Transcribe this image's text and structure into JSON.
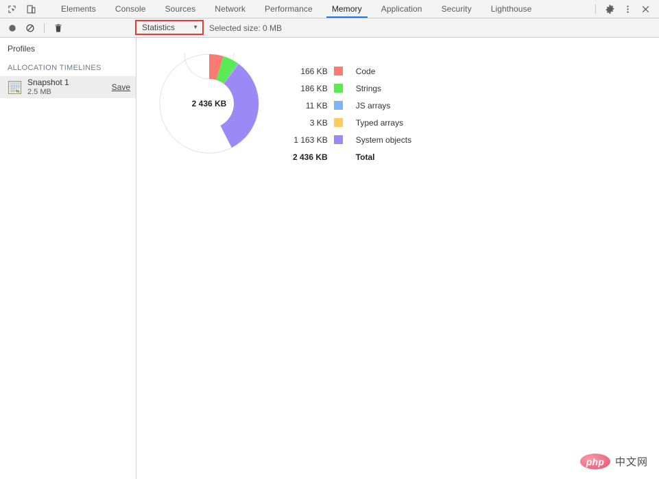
{
  "tabbar": {
    "left_icons": [
      {
        "name": "inspect-element-icon",
        "label": "Inspect element"
      },
      {
        "name": "device-toolbar-icon",
        "label": "Toggle device toolbar"
      }
    ],
    "tabs": [
      {
        "label": "Elements",
        "active": false
      },
      {
        "label": "Console",
        "active": false
      },
      {
        "label": "Sources",
        "active": false
      },
      {
        "label": "Network",
        "active": false
      },
      {
        "label": "Performance",
        "active": false
      },
      {
        "label": "Memory",
        "active": true
      },
      {
        "label": "Application",
        "active": false
      },
      {
        "label": "Security",
        "active": false
      },
      {
        "label": "Lighthouse",
        "active": false
      }
    ],
    "right_icons": [
      {
        "name": "gear-icon",
        "label": "Settings"
      },
      {
        "name": "more-vertical-icon",
        "label": "Customize and control DevTools"
      },
      {
        "name": "close-icon",
        "label": "Close DevTools"
      }
    ],
    "active_tab_underline_color": "#1a73e8"
  },
  "toolbar": {
    "icons": [
      {
        "name": "record-icon",
        "label": "Start recording heap profile"
      },
      {
        "name": "clear-icon",
        "label": "Clear all profiles"
      },
      {
        "name": "trash-icon",
        "label": "Delete profile"
      }
    ],
    "view_select": {
      "value": "Statistics",
      "caret": "▼",
      "highlight_color": "#e53935"
    },
    "selected_size": "Selected size: 0 MB"
  },
  "sidebar": {
    "title": "Profiles",
    "section_label": "ALLOCATION TIMELINES",
    "items": [
      {
        "name": "Snapshot 1",
        "size": "2.5 MB",
        "action_label": "Save",
        "icon": "heap-snapshot-icon",
        "selected": true
      }
    ]
  },
  "chart_data": {
    "type": "pie",
    "title": "Heap snapshot statistics",
    "center_label": "2 436 KB",
    "unit": "KB",
    "total": 2436,
    "scale_max": 3600,
    "legend_position": "right",
    "categories": [
      "Code",
      "Strings",
      "JS arrays",
      "Typed arrays",
      "System objects"
    ],
    "values": [
      166,
      186,
      11,
      3,
      1163
    ],
    "colors": [
      "#fa7b72",
      "#5aea54",
      "#7cb5f7",
      "#ffcb60",
      "#9b8af5"
    ],
    "rows": [
      {
        "size": "166 KB",
        "color": "#fa7b72",
        "name": "Code",
        "value": 166
      },
      {
        "size": "186 KB",
        "color": "#5aea54",
        "name": "Strings",
        "value": 186
      },
      {
        "size": "11 KB",
        "color": "#7cb5f7",
        "name": "JS arrays",
        "value": 11
      },
      {
        "size": "3 KB",
        "color": "#ffcb60",
        "name": "Typed arrays",
        "value": 3
      },
      {
        "size": "1 163 KB",
        "color": "#9b8af5",
        "name": "System objects",
        "value": 1163
      }
    ],
    "total_row": {
      "size": "2 436 KB",
      "name": "Total"
    }
  },
  "watermark": {
    "logo_text": "php",
    "text": "中文网"
  }
}
